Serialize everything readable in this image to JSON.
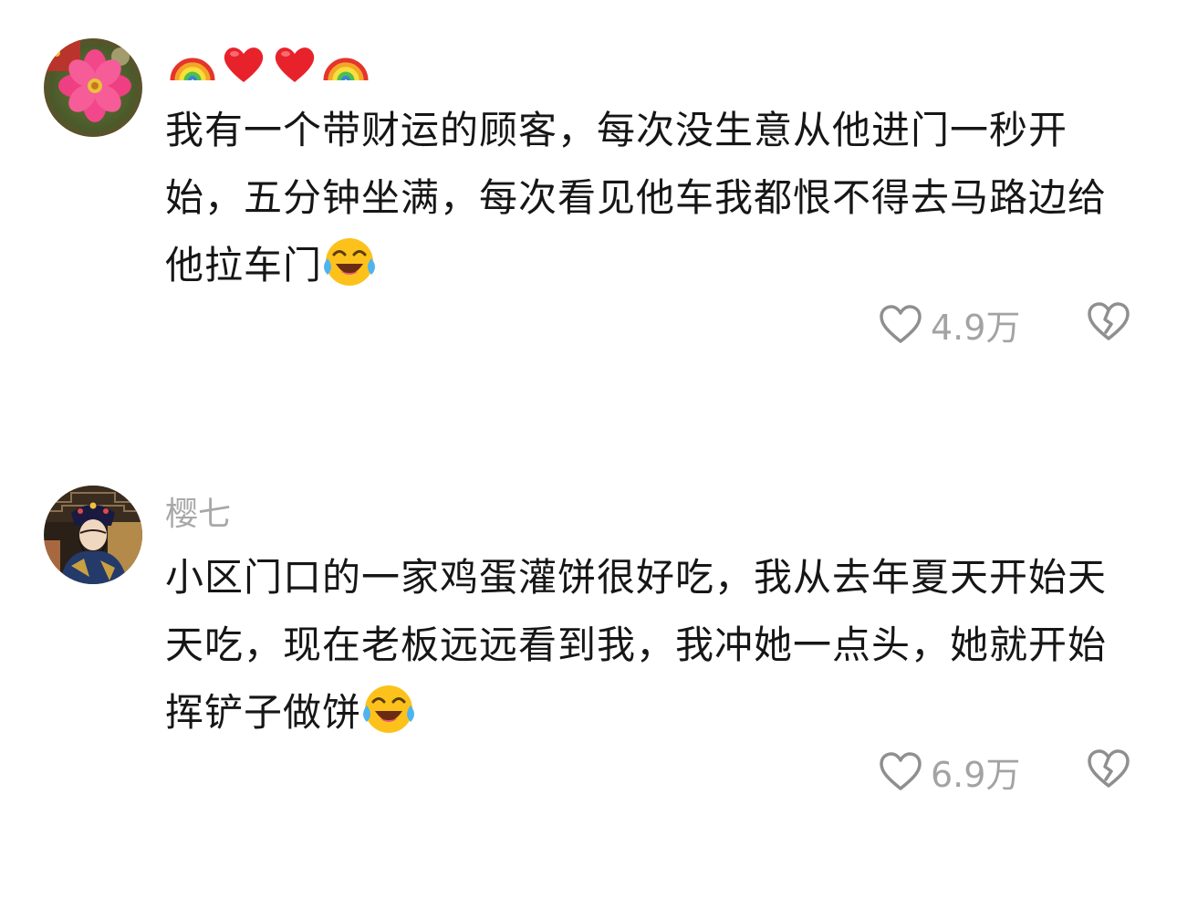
{
  "comments": [
    {
      "username": "",
      "username_emojis": [
        "rainbow-emoji",
        "red-heart-emoji",
        "red-heart-emoji",
        "rainbow-emoji"
      ],
      "avatar": "flower-avatar",
      "text_lines": [
        "我有一个带财运的顾客，每次没生意从他进门一秒开",
        "始，五分钟坐满，每次看见他车我都恨不得去马路边给",
        "他拉车门"
      ],
      "trailing_emoji": "tears-of-joy-emoji",
      "likes": "4.9万",
      "like_icon": "heart-outline-icon",
      "dislike_icon": "broken-heart-outline-icon"
    },
    {
      "username": "樱七",
      "avatar": "opera-performer-avatar",
      "text_lines": [
        "小区门口的一家鸡蛋灌饼很好吃，我从去年夏天开始天",
        "天吃，现在老板远远看到我，我冲她一点头，她就开始",
        "挥铲子做饼"
      ],
      "trailing_emoji": "tears-of-joy-emoji",
      "likes": "6.9万",
      "like_icon": "heart-outline-icon",
      "dislike_icon": "broken-heart-outline-icon"
    }
  ],
  "colors": {
    "background": "#ffffff",
    "text": "#161616",
    "muted": "#a8a8a8",
    "icon": "#9c9c9c"
  }
}
